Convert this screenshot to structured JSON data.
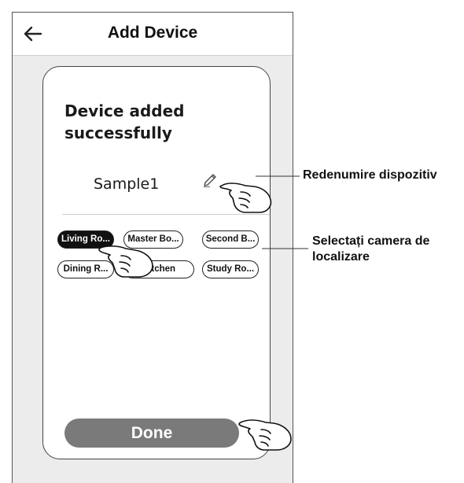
{
  "header": {
    "title": "Add Device",
    "back_icon": "arrow-left-icon"
  },
  "card": {
    "status_text": "Device added successfully",
    "device_name": "Sample1",
    "edit_icon": "pencil-icon"
  },
  "rooms": [
    {
      "label": "Living Ro...",
      "selected": true
    },
    {
      "label": "Master Bo...",
      "selected": false
    },
    {
      "label": "Second B...",
      "selected": false
    },
    {
      "label": "Dining R...",
      "selected": false
    },
    {
      "label": "Kitchen",
      "selected": false
    },
    {
      "label": "Study Ro...",
      "selected": false
    }
  ],
  "done_label": "Done",
  "callouts": {
    "rename": "Redenumire dispozitiv",
    "select_room": "Selectați camera de localizare"
  },
  "colors": {
    "done_bg": "#7a7a7a",
    "selected_room_bg": "#111111",
    "phone_bg": "#ececec"
  }
}
